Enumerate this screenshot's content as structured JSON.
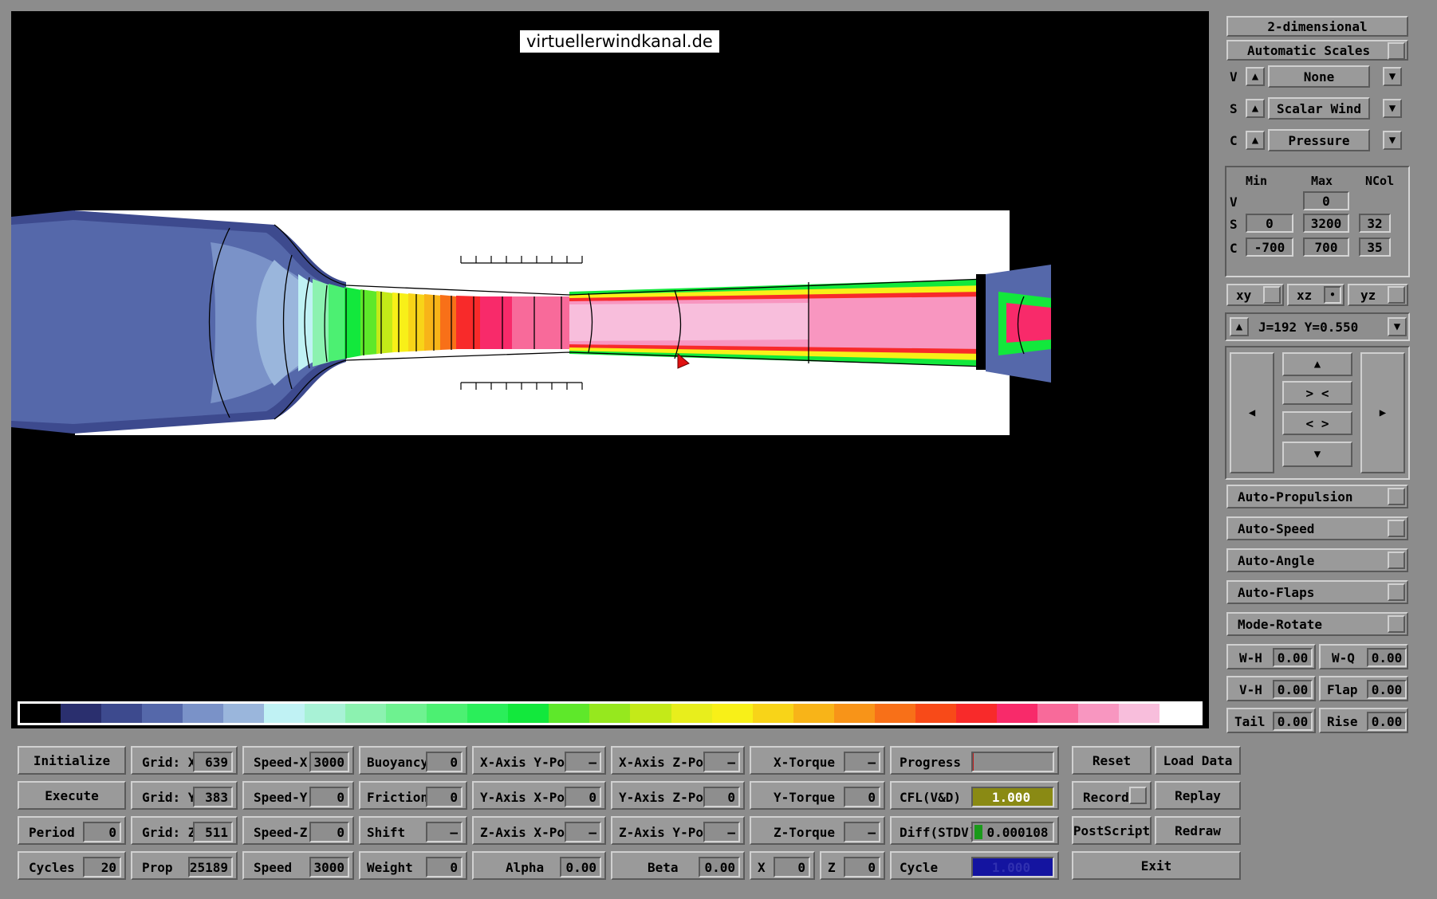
{
  "watermark": "virtuellerwindkanal.de",
  "colorbar_colors": [
    "#000000",
    "#2a2f6e",
    "#3d4a8e",
    "#5568aa",
    "#7a92c8",
    "#9ab6dc",
    "#c0f2f4",
    "#a8f2d6",
    "#8cf2b0",
    "#6ef290",
    "#4cf072",
    "#2aee5a",
    "#12e83c",
    "#5ee82a",
    "#96e81e",
    "#c4ea18",
    "#e8ee1c",
    "#f8f018",
    "#f8d418",
    "#f8b418",
    "#f89418",
    "#f87018",
    "#f84a18",
    "#f82a2a",
    "#f82a6a",
    "#f86a9a",
    "#f896c0",
    "#f8bedc",
    "#ffffff"
  ],
  "right_panel": {
    "mode": "2-dimensional",
    "auto_scales": "Automatic Scales",
    "v_select": {
      "prefix": "V",
      "value": "None"
    },
    "s_select": {
      "prefix": "S",
      "value": "Scalar Wind"
    },
    "c_select": {
      "prefix": "C",
      "value": "Pressure"
    },
    "scale_headers": {
      "min": "Min",
      "max": "Max",
      "ncol": "NCol"
    },
    "v_row": {
      "label": "V",
      "max": "0"
    },
    "s_row": {
      "label": "S",
      "min": "0",
      "max": "3200",
      "ncol": "32"
    },
    "c_row": {
      "label": "C",
      "min": "-700",
      "max": "700",
      "ncol": "35"
    },
    "planes": {
      "xy": "xy",
      "xz": "xz",
      "yz": "yz",
      "selected": "xz"
    },
    "slice": "J=192  Y=0.550",
    "nav": {
      "up": "▲",
      "shrink": "> <",
      "expand": "< >",
      "down": "▼",
      "left": "◀",
      "right": "▶"
    },
    "toggles": [
      "Auto-Propulsion",
      "Auto-Speed",
      "Auto-Angle",
      "Auto-Flaps",
      "Mode-Rotate"
    ],
    "params": [
      {
        "l1": "W-H",
        "v1": "0.00",
        "l2": "W-Q",
        "v2": "0.00"
      },
      {
        "l1": "V-H",
        "v1": "0.00",
        "l2": "Flap",
        "v2": "0.00"
      },
      {
        "l1": "Tail",
        "v1": "0.00",
        "l2": "Rise",
        "v2": "0.00"
      }
    ],
    "buttons": {
      "reset": "Reset",
      "load": "Load Data",
      "record": "Record",
      "replay": "Replay",
      "postscript": "PostScript",
      "redraw": "Redraw",
      "exit": "Exit"
    }
  },
  "bottom": {
    "col1": [
      {
        "label": "Initialize",
        "type": "button"
      },
      {
        "label": "Execute",
        "type": "button"
      },
      {
        "label": "Period",
        "value": "0"
      },
      {
        "label": "Cycles",
        "value": "20"
      }
    ],
    "col2": [
      {
        "label": "Grid: X",
        "value": "639"
      },
      {
        "label": "Grid: Y",
        "value": "383"
      },
      {
        "label": "Grid: Z",
        "value": "511"
      },
      {
        "label": "Prop",
        "value": "25189"
      }
    ],
    "col3": [
      {
        "label": "Speed-X",
        "value": "3000"
      },
      {
        "label": "Speed-Y",
        "value": "0"
      },
      {
        "label": "Speed-Z",
        "value": "0"
      },
      {
        "label": "Speed",
        "value": "3000"
      }
    ],
    "col4": [
      {
        "label": "Buoyancy",
        "value": "0"
      },
      {
        "label": "Friction",
        "value": "0"
      },
      {
        "label": "Shift",
        "value": "—"
      },
      {
        "label": "Weight",
        "value": "0"
      }
    ],
    "col5": [
      {
        "label": "X-Axis Y-Pos",
        "value": "—"
      },
      {
        "label": "Y-Axis X-Pos",
        "value": "0"
      },
      {
        "label": "Z-Axis X-Pos",
        "value": "—"
      },
      {
        "label": "Alpha",
        "value": "0.00"
      }
    ],
    "col6": [
      {
        "label": "X-Axis Z-Pos",
        "value": "—"
      },
      {
        "label": "Y-Axis Z-Pos",
        "value": "0"
      },
      {
        "label": "Z-Axis Y-Pos",
        "value": "—"
      },
      {
        "label": "Beta",
        "value": "0.00"
      }
    ],
    "col7": [
      {
        "label": "X-Torque",
        "value": "—"
      },
      {
        "label": "Y-Torque",
        "value": "0"
      },
      {
        "label": "Z-Torque",
        "value": "—"
      }
    ],
    "xz_row": {
      "x_label": "X",
      "x_value": "0",
      "z_label": "Z",
      "z_value": "0"
    },
    "status": {
      "progress_label": "Progress",
      "progress_value": 0.01,
      "cfl_label": "CFL(V&D)",
      "cfl_value": "1.000",
      "cfl_color": "#8a8a14",
      "diff_label": "Diff(STDV)",
      "diff_value": "0.000108",
      "diff_color": "#1a9a1a",
      "cycle_label": "Cycle",
      "cycle_value": "1.000",
      "cycle_color": "#1414a0"
    }
  }
}
